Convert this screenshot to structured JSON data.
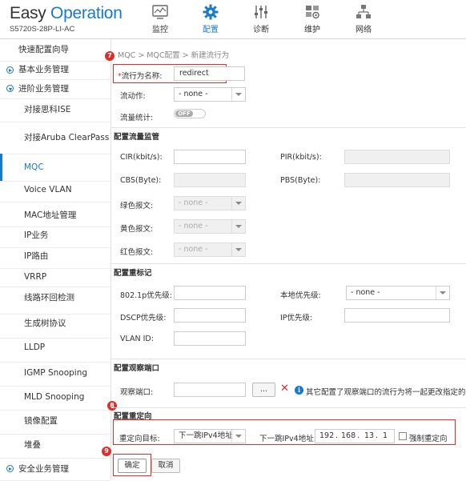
{
  "header": {
    "logo_easy": "Easy",
    "logo_operation": "Operation",
    "model": "S5720S-28P-LI-AC",
    "nav": [
      {
        "label": "监控",
        "icon": "monitor-icon"
      },
      {
        "label": "配置",
        "icon": "gear-icon"
      },
      {
        "label": "诊断",
        "icon": "sliders-icon"
      },
      {
        "label": "维护",
        "icon": "maintenance-icon"
      },
      {
        "label": "网络",
        "icon": "network-icon"
      }
    ]
  },
  "sidebar": {
    "items": [
      {
        "label": "快速配置向导"
      },
      {
        "label": "基本业务管理"
      },
      {
        "label": "进阶业务管理"
      },
      {
        "label": "对接思科ISE"
      },
      {
        "label": "对接Aruba ClearPass"
      },
      {
        "label": "MQC"
      },
      {
        "label": "Voice VLAN"
      },
      {
        "label": "MAC地址管理"
      },
      {
        "label": "IP业务"
      },
      {
        "label": "IP路由"
      },
      {
        "label": "VRRP"
      },
      {
        "label": "线路环回检测"
      },
      {
        "label": "生成树协议"
      },
      {
        "label": "LLDP"
      },
      {
        "label": "IGMP Snooping"
      },
      {
        "label": "MLD Snooping"
      },
      {
        "label": "镜像配置"
      },
      {
        "label": "堆叠"
      },
      {
        "label": "安全业务管理"
      }
    ]
  },
  "breadcrumb": "MQC > MQC配置 > 新建流行为",
  "form": {
    "behavior_name_label": "流行为名称:",
    "behavior_name_value": "redirect",
    "action_label": "流动作:",
    "action_value": "- none -",
    "stats_label": "流量统计:",
    "stats_value": "OFF",
    "section_police": "配置流量监管",
    "cir_label": "CIR(kbit/s):",
    "pir_label": "PIR(kbit/s):",
    "cbs_label": "CBS(Byte):",
    "pbs_label": "PBS(Byte):",
    "green_label": "绿色报文:",
    "yellow_label": "黄色报文:",
    "red_label": "红色报文:",
    "color_action_value": "- none -",
    "section_remark": "配置重标记",
    "p8021_label": "802.1p优先级:",
    "local_pri_label": "本地优先级:",
    "local_pri_value": "- none -",
    "dscp_label": "DSCP优先级:",
    "ip_pri_label": "IP优先级:",
    "vlan_label": "VLAN ID:",
    "section_observe": "配置观察端口",
    "observe_label": "观察端口:",
    "browse_label": "...",
    "observe_hint": "其它配置了观察端口的流行为将一起更改指定的观察",
    "section_redirect": "配置重定向",
    "redirect_target_label": "重定向目标:",
    "redirect_target_value": "下一跳IPv4地址",
    "next_hop_label": "下一跳IPv4地址:",
    "ip_oct1": "192",
    "ip_oct2": "168",
    "ip_oct3": "13",
    "ip_oct4": "1",
    "forced_label": "强制重定向",
    "ok_label": "确定",
    "cancel_label": "取消"
  },
  "annotations": {
    "step7": "7",
    "step8": "8",
    "step9": "9"
  }
}
